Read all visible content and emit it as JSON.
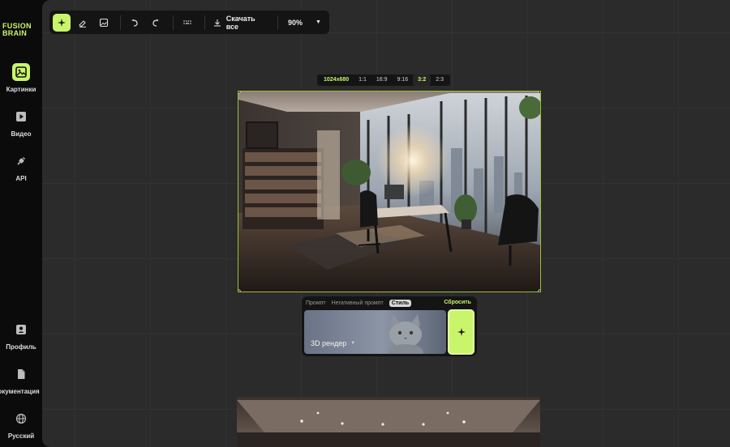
{
  "brand": {
    "line1": "FUSION",
    "line2": "BRAIN"
  },
  "sidebar": {
    "items": [
      {
        "label": "Картинки",
        "icon": "image-icon",
        "active": true
      },
      {
        "label": "Видео",
        "icon": "play-icon"
      },
      {
        "label": "API",
        "icon": "plug-icon"
      },
      {
        "label": "Профиль",
        "icon": "profile-icon"
      },
      {
        "label": "окументация",
        "icon": "document-icon"
      },
      {
        "label": "Русский",
        "icon": "globe-icon"
      }
    ]
  },
  "toolbar": {
    "download_label": "Скачать все",
    "zoom": "90%",
    "icons": [
      "sparkle-icon",
      "eraser-icon",
      "image-frame-icon",
      "undo-icon",
      "redo-icon",
      "dots-grid-icon",
      "download-icon",
      "caret-down-icon"
    ]
  },
  "ratios": {
    "resolution": "1024x680",
    "options": [
      "1:1",
      "16:9",
      "9:16",
      "3:2",
      "2:3"
    ],
    "selected": "3:2"
  },
  "prompt_panel": {
    "tabs": [
      "Промпт",
      "Негативный промпт",
      "Стиль"
    ],
    "active_tab": "Стиль",
    "reset_label": "Сбросить",
    "style_value": "3D рендер"
  },
  "colors": {
    "accent": "#c8f56a",
    "canvas": "#2b2b2b",
    "panel": "#141414",
    "sidebar": "#0b0b0b"
  }
}
